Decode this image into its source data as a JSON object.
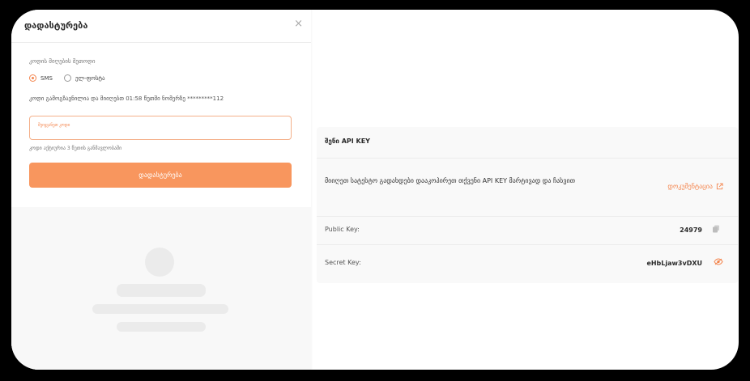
{
  "modal": {
    "title": "დადასტურება",
    "close_symbol": "×",
    "method_label": "კოდის მიღების მეთოდი",
    "options": [
      {
        "label": "SMS",
        "selected": true
      },
      {
        "label": "ელ-ფოსტა",
        "selected": false
      }
    ],
    "sent_message": "კოდი გამოგზავნილია და მიიღებთ 01:58 წუთში ნომერზე *********112",
    "code_placeholder": "შეიყვანეთ კოდი",
    "validity_note": "კოდი აქტიურია 3 წუთის განმავლობაში",
    "confirm_label": "დადასტურება"
  },
  "api": {
    "title": "შენი API KEY",
    "info_text": "მიიღეთ სატესტო გადახდები დააკოპირეთ თქვენი API KEY მარტივად და ჩასვით",
    "docs_link": "დოკუმენტაცია",
    "public_key_label": "Public Key:",
    "public_key_value": "24979",
    "secret_key_label": "Secret Key:",
    "secret_key_value": "eHbLjaw3vDXU"
  },
  "colors": {
    "accent": "#f4864f",
    "button": "#f8965e"
  },
  "icons": [
    "close-icon",
    "copy-icon",
    "eye-off-icon",
    "external-link-icon"
  ]
}
